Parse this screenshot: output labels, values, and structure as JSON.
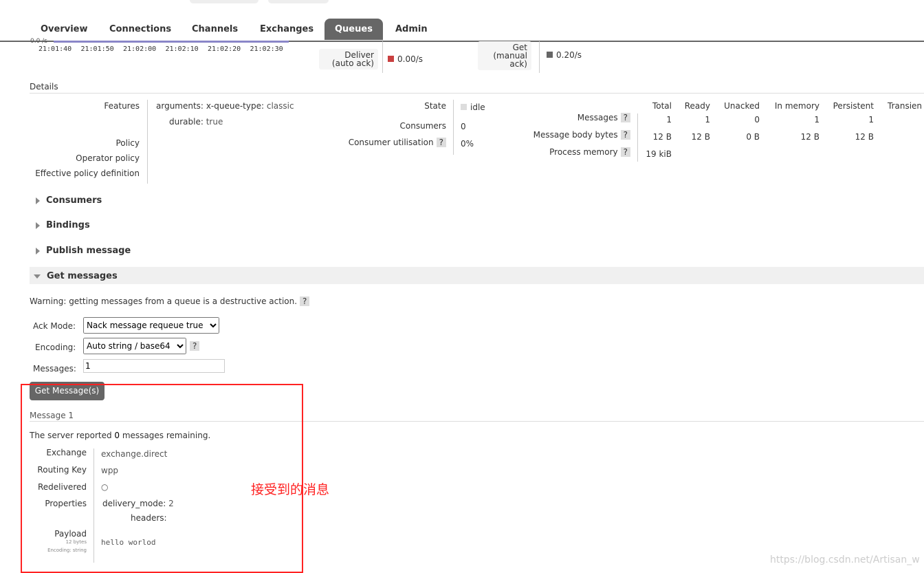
{
  "nav": {
    "tabs": [
      "Overview",
      "Connections",
      "Channels",
      "Exchanges",
      "Queues",
      "Admin"
    ],
    "selected": "Queues"
  },
  "chart": {
    "y_label": "0.0 /s",
    "x_ticks": [
      "21:01:40",
      "21:01:50",
      "21:02:00",
      "21:02:10",
      "21:02:20",
      "21:02:30"
    ]
  },
  "rates": {
    "deliver_label_1": "Deliver",
    "deliver_label_2": "(auto ack)",
    "deliver_value": "0.00/s",
    "deliver_color": "#c94040",
    "get_label_1": "Get",
    "get_label_2": "(manual",
    "get_label_3": "ack)",
    "get_value": "0.20/s",
    "get_color": "#666666"
  },
  "details": {
    "title": "Details",
    "features_label": "Features",
    "arg_key": "arguments:",
    "arg_name": "x-queue-type:",
    "arg_value": "classic",
    "durable_key": "durable:",
    "durable_value": "true",
    "policy": "Policy",
    "operator_policy": "Operator policy",
    "effective_policy": "Effective policy definition",
    "state_label": "State",
    "state_value": "idle",
    "consumers_label": "Consumers",
    "consumers_value": "0",
    "util_label": "Consumer utilisation",
    "util_value": "0%",
    "stats": {
      "columns": [
        "Total",
        "Ready",
        "Unacked",
        "In memory",
        "Persistent",
        "Transien"
      ],
      "rows": [
        {
          "label": "Messages",
          "values": [
            "1",
            "1",
            "0",
            "1",
            "1"
          ]
        },
        {
          "label": "Message body bytes",
          "values": [
            "12 B",
            "12 B",
            "0 B",
            "12 B",
            "12 B"
          ]
        },
        {
          "label": "Process memory",
          "values": [
            "19 kiB"
          ]
        }
      ]
    }
  },
  "sections": {
    "consumers": "Consumers",
    "bindings": "Bindings",
    "publish": "Publish message",
    "get": "Get messages"
  },
  "get": {
    "warning": "Warning: getting messages from a queue is a destructive action.",
    "ack_label": "Ack Mode:",
    "ack_value": "Nack message requeue true",
    "enc_label": "Encoding:",
    "enc_value": "Auto string / base64",
    "msgs_label": "Messages:",
    "msgs_value": "1",
    "button": "Get Message(s)",
    "help": "?"
  },
  "message": {
    "title": "Message 1",
    "remaining_pre": "The server reported ",
    "remaining_count": "0",
    "remaining_post": " messages remaining.",
    "exchange_label": "Exchange",
    "exchange": "exchange.direct",
    "rk_label": "Routing Key",
    "rk": "wpp",
    "redelivered_label": "Redelivered",
    "redelivered": "○",
    "props_label": "Properties",
    "dm_key": "delivery_mode:",
    "dm_value": "2",
    "headers_key": "headers:",
    "payload_label": "Payload",
    "payload_bytes": "12 bytes",
    "payload_encoding": "Encoding: string",
    "payload": "hello worlod"
  },
  "annotation": {
    "text": "接受到的消息",
    "color": "#ff2222"
  },
  "watermark": "https://blog.csdn.net/Artisan_w"
}
